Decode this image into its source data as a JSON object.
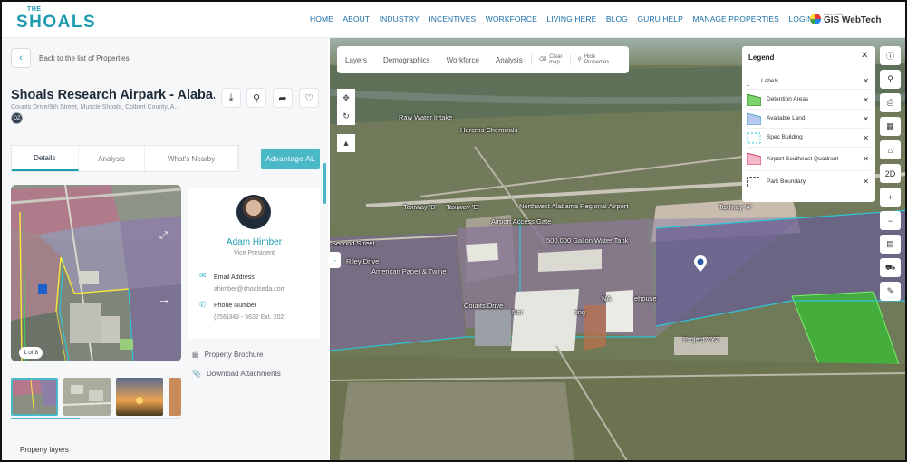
{
  "brand": {
    "the": "THE",
    "name": "SHOALS",
    "powered_by": "Powered By",
    "gis": "GIS WebTech"
  },
  "nav": [
    "HOME",
    "ABOUT",
    "INDUSTRY",
    "INCENTIVES",
    "WORKFORCE",
    "LIVING HERE",
    "BLOG",
    "GURU HELP",
    "MANAGE PROPERTIES",
    "LOGIN"
  ],
  "panel": {
    "back": "Back to the list of Properties",
    "title": "Shoals Research Airpark - Alaba...",
    "address": "Counts Drive/9th Street, Muscle Shoals, Colbert County, A...",
    "badge": "OZ",
    "tabs": [
      "Details",
      "Analysis",
      "What's Nearby"
    ],
    "advantage": "Advantage AL",
    "photo_counter": "1 of 8",
    "contact": {
      "name": "Adam Himber",
      "title": "Vice President",
      "email_label": "Email Address",
      "email": "ahimber@shoalseda.com",
      "phone_label": "Phone Number",
      "phone": "(256)349 - 5632 Ext. 202"
    },
    "brochure": "Property Brochure",
    "attachments": "Download Attachments",
    "property_layers": "Property layers"
  },
  "map": {
    "tools": [
      "Layers",
      "Demographics",
      "Workforce",
      "Analysis"
    ],
    "clear_map": [
      "Clear",
      "map"
    ],
    "hide_props": [
      "Hide",
      "Properties"
    ],
    "legend_title": "Legend",
    "legend": [
      {
        "name": "Labels",
        "color": "#ffffff"
      },
      {
        "name": "Detention Areas",
        "color": "#7bd36a"
      },
      {
        "name": "Available Land",
        "color": "#9fd8f0"
      },
      {
        "name": "Spec Building",
        "color": "#2ec4d6"
      },
      {
        "name": "Airport Southeast Quadrant",
        "color": "#f2a3b8"
      },
      {
        "name": "Park Boundary",
        "color": "#222222"
      }
    ],
    "labels": [
      "Raw Water Intake",
      "Harcros Chemicals",
      "Taxiway 'B'",
      "Taxiway 'E'",
      "Northwest Alabama Regional Airport",
      "Airport Access Gate",
      "Taxiway 'A'",
      "500,000 Gallon Water Tank",
      "Riley Drive",
      "American Paper & Twine",
      "Counts Drive",
      "Nor",
      "ting",
      "NA",
      "ehouse",
      "Project XYZ",
      "Second Street"
    ],
    "right_2d": "2D"
  }
}
